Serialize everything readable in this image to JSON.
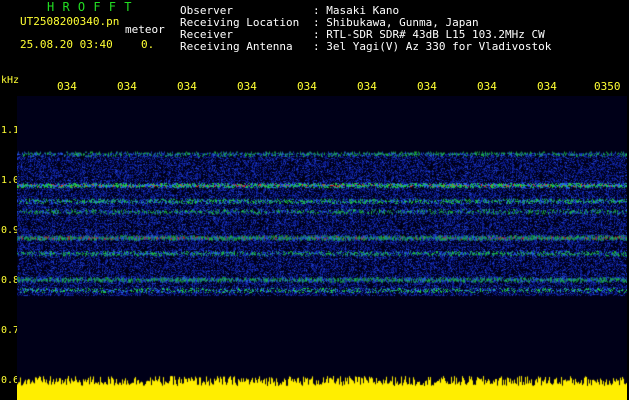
{
  "header": {
    "title": "H R O F F T",
    "file_name": "UT2508200340.pn",
    "meteor_label": "meteor",
    "date_time": "25.08.20 03:40",
    "count": "0.",
    "fields": [
      {
        "label": "Observer",
        "value": ": Masaki Kano"
      },
      {
        "label": "Receiving Location",
        "value": ": Shibukawa, Gunma, Japan"
      },
      {
        "label": "Receiver",
        "value": ": RTL-SDR SDR# 43dB L15 103.2MHz CW"
      },
      {
        "label": "Receiving Antenna",
        "value": ": 3el Yagi(V) Az 330 for Vladivostok"
      }
    ]
  },
  "y_axis": {
    "unit": "kHz",
    "ticks": [
      "1.1",
      "1.0",
      "0.9",
      "0.8",
      "0.7",
      "0.6"
    ]
  },
  "x_axis": {
    "ticks": [
      "034",
      "034",
      "034",
      "034",
      "034",
      "034",
      "034",
      "034",
      "034",
      "0350"
    ]
  },
  "colors": {
    "background": "#000018",
    "noise_band": "#0a1a8a",
    "signal_green": "#22dd44",
    "signal_red": "#ff3322",
    "level_bar": "#ffee00",
    "label_yellow": "#ffff33"
  },
  "spectrogram": {
    "freq_range_khz": [
      0.58,
      1.16
    ],
    "noise_band_khz": [
      0.78,
      1.05
    ],
    "signal_lines_khz": [
      {
        "f": 1.05,
        "strength": 0.5
      },
      {
        "f": 0.99,
        "strength": 1.0
      },
      {
        "f": 0.96,
        "strength": 0.7
      },
      {
        "f": 0.94,
        "strength": 0.5
      },
      {
        "f": 0.89,
        "strength": 1.0
      },
      {
        "f": 0.86,
        "strength": 0.6
      },
      {
        "f": 0.81,
        "strength": 0.8
      },
      {
        "f": 0.79,
        "strength": 0.5
      }
    ]
  }
}
